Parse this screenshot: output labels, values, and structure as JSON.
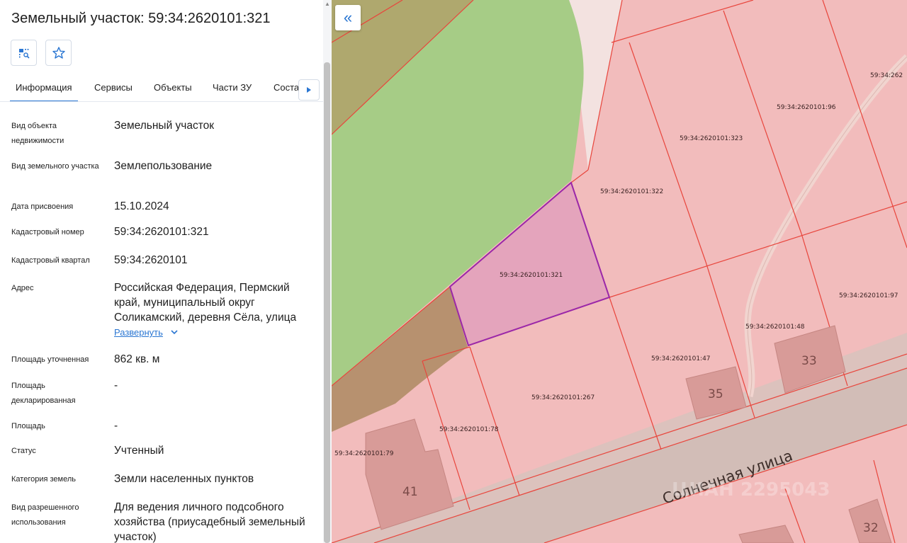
{
  "panel": {
    "title": "Земельный участок: 59:34:2620101:321",
    "tabs": [
      "Информация",
      "Сервисы",
      "Объекты",
      "Части ЗУ",
      "Соста"
    ],
    "fields": [
      {
        "label": "Вид объекта недвижимости",
        "value": "Земельный участок"
      },
      {
        "label": "Вид земельного участка",
        "value": "Землепользование"
      },
      {
        "label": "Дата присвоения",
        "value": "15.10.2024"
      },
      {
        "label": "Кадастровый номер",
        "value": "59:34:2620101:321"
      },
      {
        "label": "Кадастровый квартал",
        "value": "59:34:2620101"
      },
      {
        "label": "Адрес",
        "value": "Российская Федерация, Пермский край, муниципальный округ Соликамский, деревня Сёла, улица"
      },
      {
        "label": "Площадь уточненная",
        "value": "862 кв. м"
      },
      {
        "label": "Площадь декларированная",
        "value": "-"
      },
      {
        "label": "Площадь",
        "value": "-"
      },
      {
        "label": "Статус",
        "value": "Учтенный"
      },
      {
        "label": "Категория земель",
        "value": "Земли населенных пунктов"
      },
      {
        "label": "Вид разрешенного использования",
        "value": "Для ведения личного подсобного хозяйства (приусадебный земельный участок)"
      }
    ],
    "expand_label": "Развернуть"
  },
  "map": {
    "collapse_icon": "«",
    "parcels": [
      "59:34:2620101:321",
      "59:34:2620101:322",
      "59:34:2620101:323",
      "59:34:2620101:96",
      "59:34:2620101:48",
      "59:34:2620101:47",
      "59:34:2620101:97",
      "59:34:2620101:267",
      "59:34:2620101:78",
      "59:34:2620101:79",
      "59:34:262"
    ],
    "houses": [
      "33",
      "35",
      "41",
      "32"
    ],
    "street": "Солнечная улица",
    "watermark": "ЦИАН 2295043"
  },
  "colors": {
    "accent": "#2a76d2",
    "selected_parcel": "#9b27a8",
    "parcel_border": "#e8453c",
    "parcel_fill": "#f2b9b9",
    "forest": "#a5cd85"
  }
}
